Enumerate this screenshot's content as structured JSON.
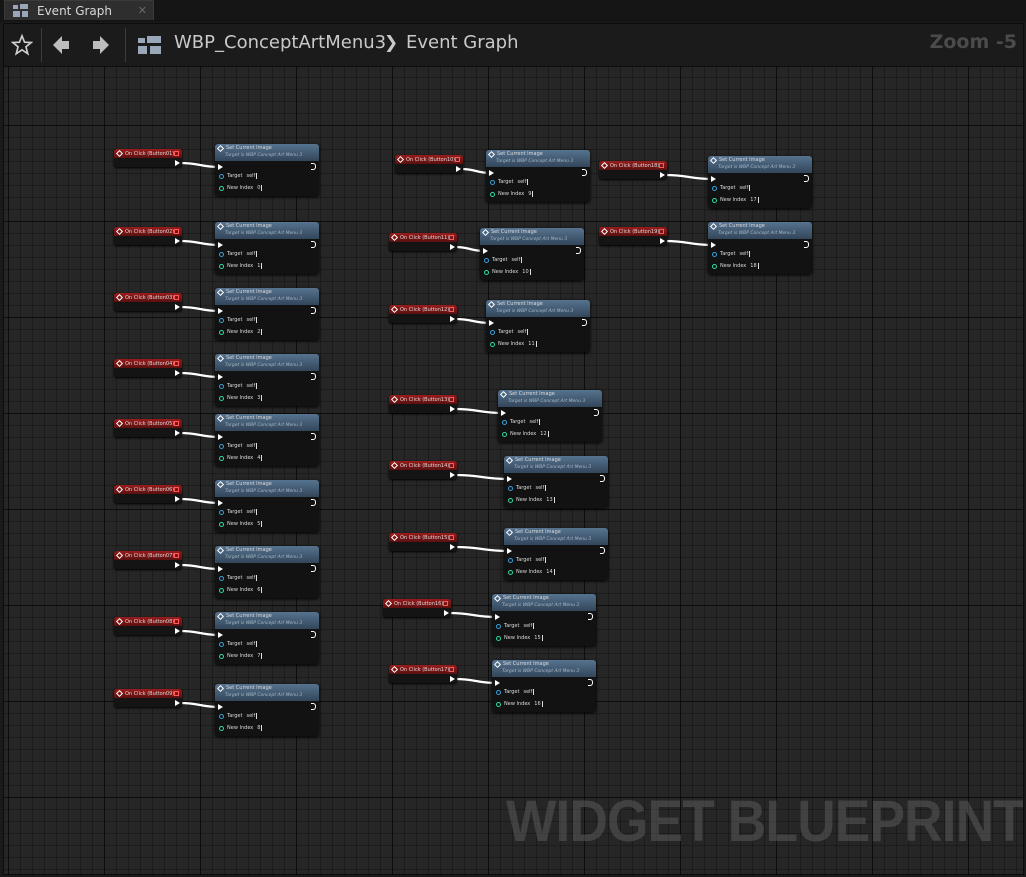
{
  "tab": {
    "title": "Event Graph",
    "close": "✕"
  },
  "toolbar": {
    "breadcrumb_blueprint": "WBP_ConceptArtMenu3",
    "breadcrumb_graph": "Event Graph",
    "chevron": "❯",
    "zoom": "Zoom -5"
  },
  "node_common": {
    "function_title": "Set Current Image",
    "function_subtitle": "Target is WBP Concept Art Menu 3",
    "target_label": "Target",
    "target_value": "self",
    "index_label": "New Index"
  },
  "pairs": [
    {
      "event": "On Click (Button01)",
      "index": "0"
    },
    {
      "event": "On Click (Button02)",
      "index": "1"
    },
    {
      "event": "On Click (Button03)",
      "index": "2"
    },
    {
      "event": "On Click (Button04)",
      "index": "3"
    },
    {
      "event": "On Click (Button05)",
      "index": "4"
    },
    {
      "event": "On Click (Button06)",
      "index": "5"
    },
    {
      "event": "On Click (Button07)",
      "index": "6"
    },
    {
      "event": "On Click (Button08)",
      "index": "7"
    },
    {
      "event": "On Click (Button09)",
      "index": "8"
    },
    {
      "event": "On Click (Button10)",
      "index": "9"
    },
    {
      "event": "On Click (Button11)",
      "index": "10"
    },
    {
      "event": "On Click (Button12)",
      "index": "11"
    },
    {
      "event": "On Click (Button13)",
      "index": "12"
    },
    {
      "event": "On Click (Button14)",
      "index": "13"
    },
    {
      "event": "On Click (Button15)",
      "index": "14"
    },
    {
      "event": "On Click (Button16)",
      "index": "15"
    },
    {
      "event": "On Click (Button17)",
      "index": "16"
    },
    {
      "event": "On Click (Button18)",
      "index": "17"
    },
    {
      "event": "On Click (Button19)",
      "index": "18"
    }
  ],
  "watermark": "WIDGET BLUEPRINT",
  "colors": {
    "event_header": "#9a1c1c",
    "function_header": "#56738f",
    "exec_wire": "#ffffff",
    "target_pin": "#3aa0d8",
    "index_pin": "#2fd9a0"
  },
  "icons": {
    "tab": "graph-icon",
    "favorite": "star-icon",
    "back": "arrow-left-icon",
    "forward": "arrow-right-icon",
    "blueprint": "blueprint-icon"
  }
}
